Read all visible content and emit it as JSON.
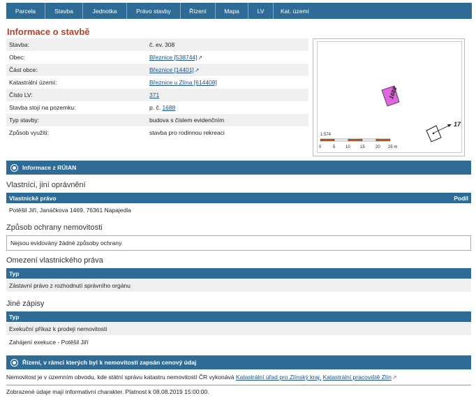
{
  "tabs": [
    "Parcela",
    "Stavba",
    "Jednotka",
    "Právo stavby",
    "Řízení",
    "Mapa",
    "LV",
    "Kat. území"
  ],
  "page_title": "Informace o stavbě",
  "info": {
    "stavba_label": "Stavba:",
    "stavba_value": "č. ev. 308",
    "obec_label": "Obec:",
    "obec_value": "Březnice [538744]",
    "cast_label": "Část obce:",
    "cast_value": "Březnice [14401]",
    "ku_label": "Katastrální území:",
    "ku_value": "Březnice u Zlína [614408]",
    "lv_label": "Číslo LV:",
    "lv_value": "371",
    "pozemek_label": "Stavba stojí na pozemku:",
    "pozemek_prefix": "p. č.",
    "pozemek_value": "1688",
    "typ_label": "Typ stavby:",
    "typ_value": "budova s číslem evidenčním",
    "vyuziti_label": "Způsob využití:",
    "vyuziti_value": "stavba pro rodinnou rekreaci"
  },
  "map": {
    "parcel_label": "1688",
    "neighbor_label": "17",
    "scale_ratio": "1:574",
    "scale_ticks": [
      "0",
      "5",
      "10",
      "15",
      "20",
      "25 m"
    ]
  },
  "ruian_title": "Informace z RÚIAN",
  "owners": {
    "title": "Vlastníci, jiní oprávnění",
    "col_left": "Vlastnické právo",
    "col_right": "Podíl",
    "row": "Potěšil Jiří, Janáčkova 1469, 76361 Napajedla"
  },
  "protection": {
    "title": "Způsob ochrany nemovitosti",
    "value": "Nejsou evidovány žádné způsoby ochrany."
  },
  "restrictions": {
    "title": "Omezení vlastnického práva",
    "col": "Typ",
    "row": "Zástavní právo z rozhodnutí správního orgánu"
  },
  "other": {
    "title": "Jiné zápisy",
    "col": "Typ",
    "rows": [
      "Exekuční příkaz k prodeji nemovitosti",
      "Zahájení exekuce - Potěšil Jiří"
    ]
  },
  "proceedings_title": "Řízení, v rámci kterých byl k nemovitosti zapsán cenový údaj",
  "office": {
    "prefix": "Nemovitost je v územním obvodu, kde státní správu katastru nemovitostí ČR vykonává",
    "link1": "Katastrální úřad pro Zlínský kraj,",
    "link2": "Katastrální pracoviště Zlín"
  },
  "footer": "Zobrazené údaje mají informativní charakter. Platnost k 08.08.2019 15:00:00.",
  "colors": {
    "bar": "#2e6c97",
    "title": "#b5402a",
    "link": "#1a4f8c",
    "building": "#e066e0"
  }
}
